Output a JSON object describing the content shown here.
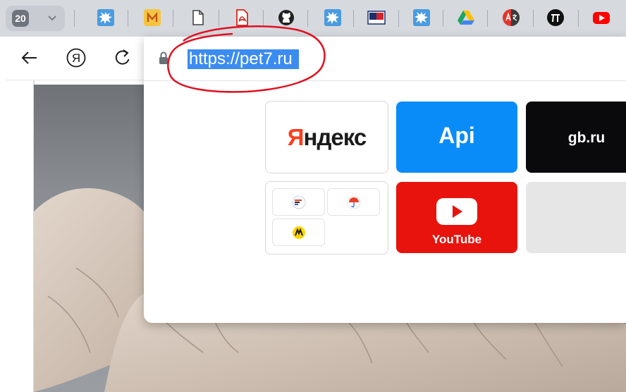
{
  "tabstrip": {
    "tab_count": "20",
    "tabs": [
      {
        "icon": "paint-splash-icon"
      },
      {
        "icon": "m-letter-icon"
      },
      {
        "icon": "document-icon"
      },
      {
        "icon": "pdf-icon"
      },
      {
        "icon": "github-icon"
      },
      {
        "icon": "paint-splash-icon"
      },
      {
        "icon": "cb-logo-icon"
      },
      {
        "icon": "paint-splash-icon"
      },
      {
        "icon": "google-drive-icon"
      },
      {
        "icon": "translate-icon"
      },
      {
        "icon": "pi-icon"
      },
      {
        "icon": "youtube-icon"
      }
    ]
  },
  "toolbar": {
    "yandex_button_glyph": "Я"
  },
  "omnibox": {
    "url": "https://pet7.ru"
  },
  "tiles": {
    "yandex": {
      "first": "Я",
      "rest": "ндекс"
    },
    "api": {
      "label": "Api"
    },
    "gb": {
      "label": "gb.ru"
    },
    "youtube": {
      "label": "YouTube"
    }
  },
  "colors": {
    "api_tile": "#0a8cf8",
    "youtube_tile": "#e8130d",
    "url_selection": "#3b8cf0",
    "annotation": "#e01020"
  }
}
